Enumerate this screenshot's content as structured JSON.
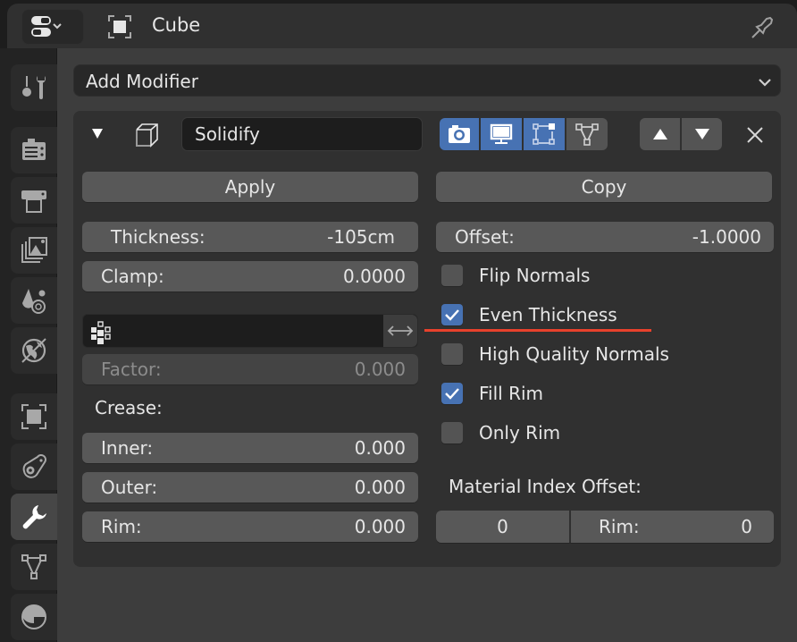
{
  "header": {
    "editor_type_icon": "properties-editor-icon",
    "object_icon": "object-icon",
    "object_name": "Cube",
    "pin_icon": "pin-icon"
  },
  "sidebar": {
    "tabs": [
      {
        "name": "tool",
        "icon": "tool-settings-icon",
        "active": false
      },
      {
        "name": "render",
        "icon": "render-camera-icon",
        "active": false
      },
      {
        "name": "output",
        "icon": "output-printer-icon",
        "active": false
      },
      {
        "name": "view-layer",
        "icon": "view-layer-icon",
        "active": false
      },
      {
        "name": "scene",
        "icon": "scene-icon",
        "active": false
      },
      {
        "name": "world",
        "icon": "world-icon",
        "active": false
      },
      {
        "name": "object",
        "icon": "object-icon",
        "active": false
      },
      {
        "name": "physics",
        "icon": "physics-icon",
        "active": false
      },
      {
        "name": "modifiers",
        "icon": "wrench-icon",
        "active": true
      },
      {
        "name": "data",
        "icon": "mesh-data-icon",
        "active": false
      },
      {
        "name": "material",
        "icon": "material-icon",
        "active": false
      }
    ]
  },
  "add_modifier": {
    "label": "Add Modifier"
  },
  "modifier": {
    "expanded": true,
    "name": "Solidify",
    "visibility": {
      "render": true,
      "viewport": true,
      "edit_mode": true,
      "cage": false
    },
    "apply_label": "Apply",
    "copy_label": "Copy",
    "thickness": {
      "label": "Thickness:",
      "value": "-105cm"
    },
    "clamp": {
      "label": "Clamp:",
      "value": "0.0000"
    },
    "offset": {
      "label": "Offset:",
      "value": "-1.0000"
    },
    "vertex_group": {
      "value": "",
      "invert_icon": "swap-arrows-icon"
    },
    "factor": {
      "label": "Factor:",
      "value": "0.000",
      "disabled": true
    },
    "crease": {
      "label": "Crease:",
      "inner": {
        "label": "Inner:",
        "value": "0.000"
      },
      "outer": {
        "label": "Outer:",
        "value": "0.000"
      },
      "rim": {
        "label": "Rim:",
        "value": "0.000"
      }
    },
    "checkboxes": [
      {
        "label": "Flip Normals",
        "checked": false
      },
      {
        "label": "Even Thickness",
        "checked": true,
        "highlighted": true
      },
      {
        "label": "High Quality Normals",
        "checked": false
      },
      {
        "label": "Fill Rim",
        "checked": true
      },
      {
        "label": "Only Rim",
        "checked": false
      }
    ],
    "material_index_offset": {
      "label": "Material Index Offset:",
      "value": "0",
      "rim_label": "Rim:",
      "rim_value": "0"
    }
  },
  "colors": {
    "accent_blue": "#4772b3",
    "highlight_underline": "#e8412c"
  }
}
